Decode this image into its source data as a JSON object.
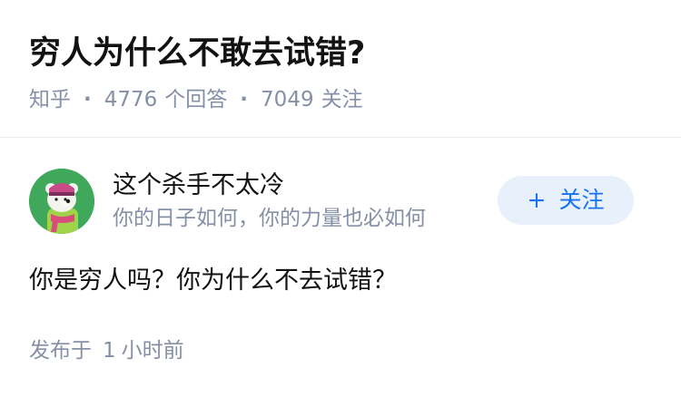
{
  "question": {
    "title": "穷人为什么不敢去试错?",
    "source": "知乎",
    "answer_count": "4776",
    "answer_label": "个回答",
    "follower_count": "7049",
    "follower_label": "关注",
    "separator": "·"
  },
  "author": {
    "avatar_icon": "bear-avatar-icon",
    "name": "这个杀手不太冷",
    "headline": "你的日子如何，你的力量也必如何",
    "follow_icon": "plus-icon",
    "follow_plus": "+",
    "follow_label": "关注"
  },
  "answer": {
    "content": "你是穷人吗？你为什么不去试错？",
    "published_prefix": "发布于",
    "published_number": "1",
    "published_unit": "小时前"
  },
  "colors": {
    "meta_gray": "#8590a6",
    "follow_blue": "#1772f6",
    "follow_bg": "#e8f1fb",
    "avatar_green": "#3fa85a"
  }
}
